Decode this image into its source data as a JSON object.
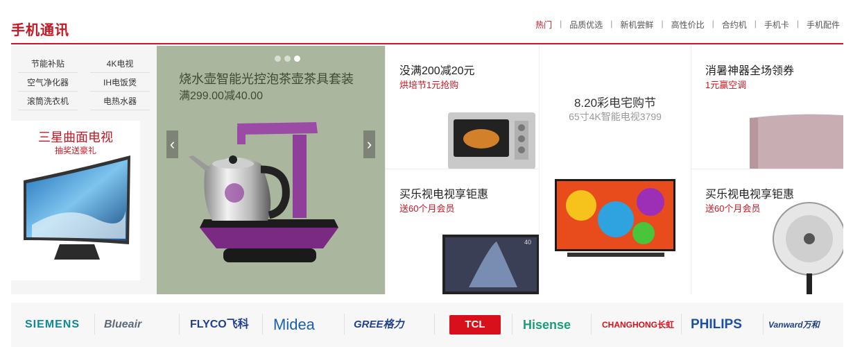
{
  "header": {
    "title": "手机通讯",
    "tabs": [
      "热门",
      "品质优选",
      "新机尝鲜",
      "高性价比",
      "合约机",
      "手机卡",
      "手机配件"
    ]
  },
  "left": {
    "categories": [
      "节能补贴",
      "4K电视",
      "空气净化器",
      "IH电饭煲",
      "滚筒洗衣机",
      "电热水器"
    ],
    "promo_title": "三星曲面电视",
    "promo_sub": "抽奖送豪礼"
  },
  "carousel": {
    "title": "烧水壶智能光控泡茶壶茶具套装",
    "subtitle": "满299.00减40.00",
    "prev_glyph": "‹",
    "next_glyph": "›",
    "slides": 3,
    "active_slide": 3
  },
  "grid": {
    "c1": {
      "title": "没满200减20元",
      "sub": "烘培节1元抢购"
    },
    "c2": {
      "title": "买乐视电视享钜惠",
      "sub": "送60个月会员"
    },
    "c3": {
      "title": "8.20彩电宅购节",
      "sub": "65寸4K智能电视3799"
    },
    "c4": {
      "title": "消暑神器全场领券",
      "sub": "1元赢空调"
    },
    "c5": {
      "title": "买乐视电视享钜惠",
      "sub": "送60个月会员"
    }
  },
  "tv_badge": "40",
  "brands": [
    "SIEMENS",
    "Blueair",
    "FLYCO飞科",
    "Midea",
    "GREE格力",
    "TCL",
    "Hisense",
    "CHANGHONG长虹",
    "PHILIPS",
    "Vanward万和"
  ],
  "colors": {
    "accent": "#c81623",
    "carousel_bg": "#aab69e"
  }
}
